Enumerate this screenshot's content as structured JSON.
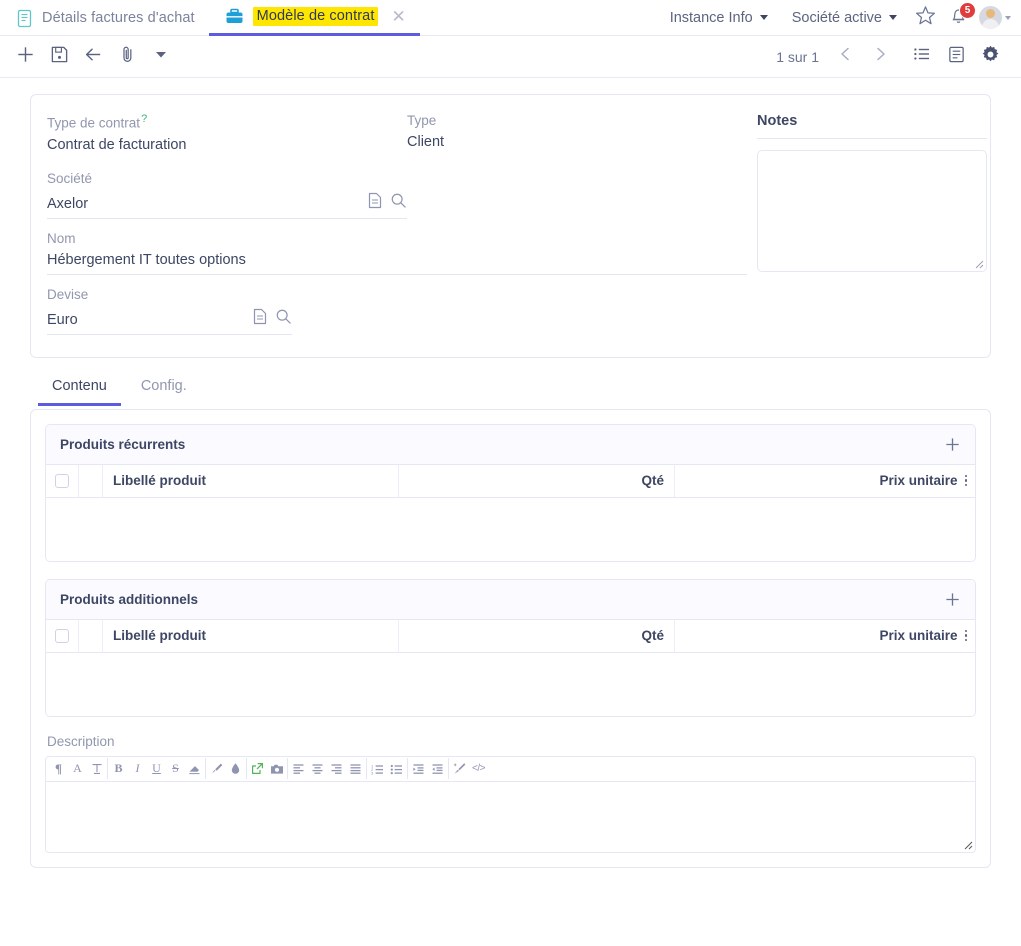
{
  "topbar": {
    "tabs": [
      {
        "label": "Détails factures d'achat",
        "icon": "document-icon",
        "active": false,
        "closable": false
      },
      {
        "label": "Modèle de contrat",
        "icon": "briefcase-icon",
        "active": true,
        "closable": true,
        "highlight_color": "#ffe600"
      }
    ],
    "menus": [
      {
        "label": "Instance Info",
        "name": "instance-info-menu"
      },
      {
        "label": "Société active",
        "name": "active-company-menu"
      }
    ],
    "favorite_icon": "star-icon",
    "notifications": {
      "icon": "bell-icon",
      "count": "5",
      "badge_color": "#e13c3c"
    },
    "avatar": {
      "icon": "avatar-icon"
    }
  },
  "toolbar": {
    "buttons": [
      {
        "name": "new-record-button",
        "icon": "plus-icon"
      },
      {
        "name": "save-button",
        "icon": "save-icon"
      },
      {
        "name": "back-button",
        "icon": "arrow-left-icon"
      },
      {
        "name": "attachment-button",
        "icon": "paperclip-icon"
      },
      {
        "name": "more-actions-button",
        "icon": "chevron-down-icon"
      }
    ],
    "pager_text": "1 sur 1",
    "prev_icon": "chevron-left-icon",
    "next_icon": "chevron-right-icon",
    "list-view-icon": "list-icon",
    "form-view-icon": "form-icon",
    "settings-icon": "gear-icon"
  },
  "form": {
    "fields": [
      {
        "label": "Type de contrat",
        "help": "?",
        "value": "Contrat de facturation",
        "name": "contract-type-field"
      },
      {
        "label": "Société",
        "value": "Axelor",
        "name": "company-field",
        "icons": [
          "document-icon",
          "search-icon"
        ]
      },
      {
        "label": "Nom",
        "value": "Hébergement IT toutes options",
        "name": "name-field"
      },
      {
        "label": "Devise",
        "value": "Euro",
        "name": "currency-field",
        "icons": [
          "document-icon",
          "search-icon"
        ]
      }
    ],
    "type": {
      "label": "Type",
      "value": "Client"
    },
    "notes": {
      "title": "Notes",
      "value": "",
      "placeholder": ""
    }
  },
  "tabs": [
    {
      "label": "Contenu",
      "name": "tab-contenu",
      "active": true
    },
    {
      "label": "Config.",
      "name": "tab-config",
      "active": false
    }
  ],
  "grids": [
    {
      "title": "Produits récurrents",
      "name": "recurring-products-grid",
      "add_icon": "plus-icon",
      "columns": [
        "Libellé produit",
        "Qté",
        "Prix unitaire"
      ],
      "rows": []
    },
    {
      "title": "Produits additionnels",
      "name": "additional-products-grid",
      "add_icon": "plus-icon",
      "columns": [
        "Libellé produit",
        "Qté",
        "Prix unitaire"
      ],
      "rows": []
    }
  ],
  "description": {
    "label": "Description",
    "value": "",
    "toolbar_groups": [
      [
        "paragraph-icon",
        "font-size-icon",
        "text-style-icon"
      ],
      [
        "bold-icon",
        "italic-icon",
        "underline-icon",
        "strikethrough-icon",
        "eraser-icon"
      ],
      [
        "brush-icon",
        "color-drop-icon"
      ],
      [
        "link-icon",
        "image-icon"
      ],
      [
        "align-left-icon",
        "align-center-icon",
        "align-right-icon",
        "align-justify-icon"
      ],
      [
        "ordered-list-icon",
        "unordered-list-icon"
      ],
      [
        "indent-icon",
        "outdent-icon"
      ],
      [
        "magic-wand-icon",
        "code-view-icon"
      ]
    ]
  },
  "colors": {
    "accent": "#5c5ce0",
    "border": "#e6e7f4",
    "text": "#3d4663",
    "muted": "#9197ae",
    "highlight": "#ffe600",
    "badge": "#e13c3c",
    "help": "#3cb878"
  }
}
